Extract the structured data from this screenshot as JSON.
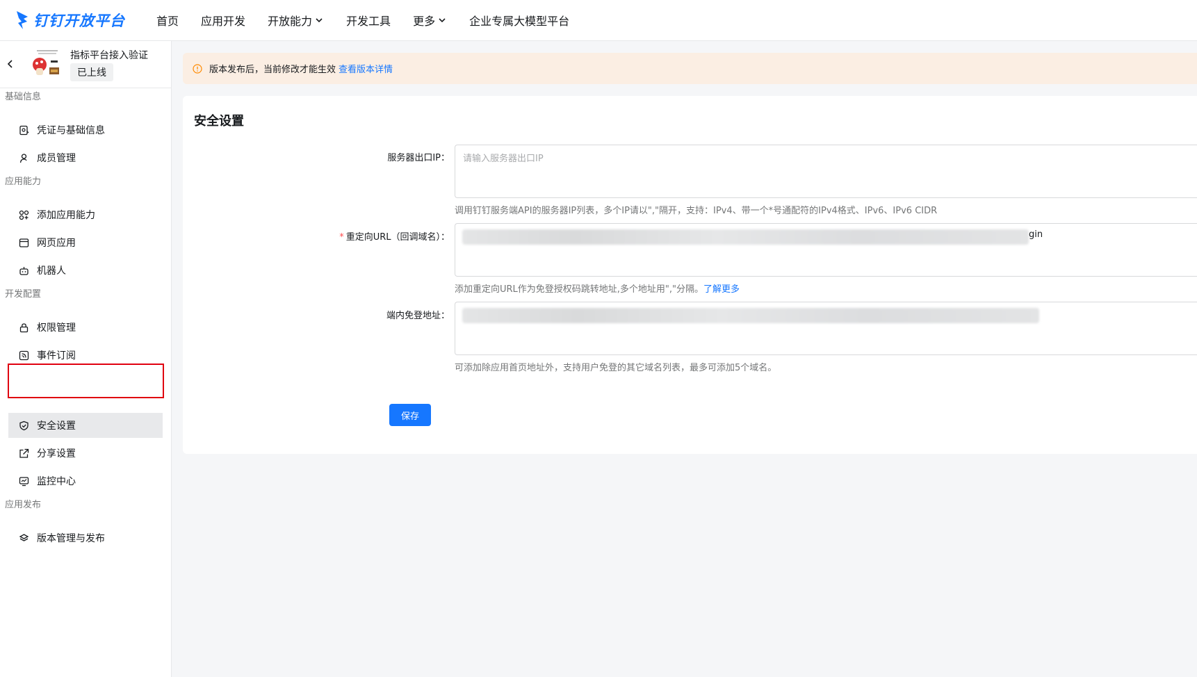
{
  "brand": {
    "name": "钉钉开放平台",
    "color": "#1677ff"
  },
  "nav": {
    "items": [
      {
        "label": "首页",
        "dropdown": false
      },
      {
        "label": "应用开发",
        "dropdown": false
      },
      {
        "label": "开放能力",
        "dropdown": true
      },
      {
        "label": "开发工具",
        "dropdown": false
      },
      {
        "label": "更多",
        "dropdown": true
      },
      {
        "label": "企业专属大模型平台",
        "dropdown": false
      }
    ]
  },
  "app": {
    "name": "指标平台接入验证",
    "status": "已上线"
  },
  "sidebar": {
    "groups": [
      {
        "title": "基础信息",
        "items": [
          {
            "label": "凭证与基础信息",
            "icon": "credential-icon"
          },
          {
            "label": "成员管理",
            "icon": "user-icon"
          }
        ]
      },
      {
        "title": "应用能力",
        "items": [
          {
            "label": "添加应用能力",
            "icon": "apps-add-icon"
          },
          {
            "label": "网页应用",
            "icon": "web-app-icon"
          },
          {
            "label": "机器人",
            "icon": "robot-icon"
          }
        ]
      },
      {
        "title": "开发配置",
        "items": [
          {
            "label": "权限管理",
            "icon": "lock-icon"
          },
          {
            "label": "事件订阅",
            "icon": "rss-icon"
          },
          {
            "label": "安全设置",
            "icon": "shield-icon",
            "active": true
          },
          {
            "label": "分享设置",
            "icon": "share-icon"
          },
          {
            "label": "监控中心",
            "icon": "monitor-icon"
          }
        ]
      },
      {
        "title": "应用发布",
        "items": [
          {
            "label": "版本管理与发布",
            "icon": "layers-icon"
          }
        ]
      }
    ]
  },
  "alert": {
    "text": "版本发布后，当前修改才能生效",
    "link": "查看版本详情"
  },
  "main": {
    "title": "安全设置",
    "fields": {
      "server_ip": {
        "label": "服务器出口IP：",
        "placeholder": "请输入服务器出口IP",
        "value": "",
        "help": "调用钉钉服务端API的服务器IP列表，多个IP请以\",\"隔开，支持：IPv4、带一个*号通配符的IPv4格式、IPv6、IPv6 CIDR"
      },
      "redirect_url": {
        "label": "重定向URL（回调域名）：",
        "required": true,
        "visible_tail": "gin",
        "help": "添加重定向URL作为免登授权码跳转地址,多个地址用\",\"分隔。",
        "help_link": "了解更多"
      },
      "sso_domain": {
        "label": "端内免登地址：",
        "help": "可添加除应用首页地址外，支持用户免登的其它域名列表，最多可添加5个域名。"
      }
    },
    "save_label": "保存"
  }
}
